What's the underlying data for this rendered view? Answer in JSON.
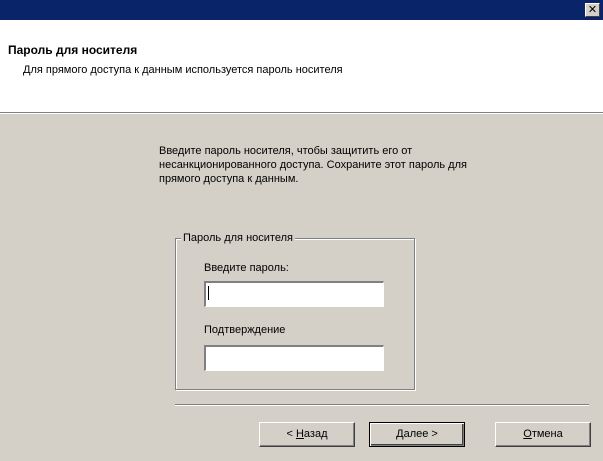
{
  "window": {
    "close_glyph": "✕"
  },
  "header": {
    "title": "Пароль для носителя",
    "subtitle": "Для прямого доступа к данным используется пароль носителя"
  },
  "instruction": "Введите пароль носителя, чтобы защитить его от несанкционированного доступа. Сохраните этот пароль для прямого доступа к данным.",
  "group": {
    "legend": "Пароль для носителя",
    "password_label": "Введите пароль:",
    "password_value": "",
    "confirm_label": "Подтверждение",
    "confirm_value": ""
  },
  "buttons": {
    "back_prefix": "< ",
    "back_accel": "Н",
    "back_rest": "азад",
    "next_accel": "Д",
    "next_rest": "алее >",
    "cancel_accel": "О",
    "cancel_rest": "тмена"
  }
}
